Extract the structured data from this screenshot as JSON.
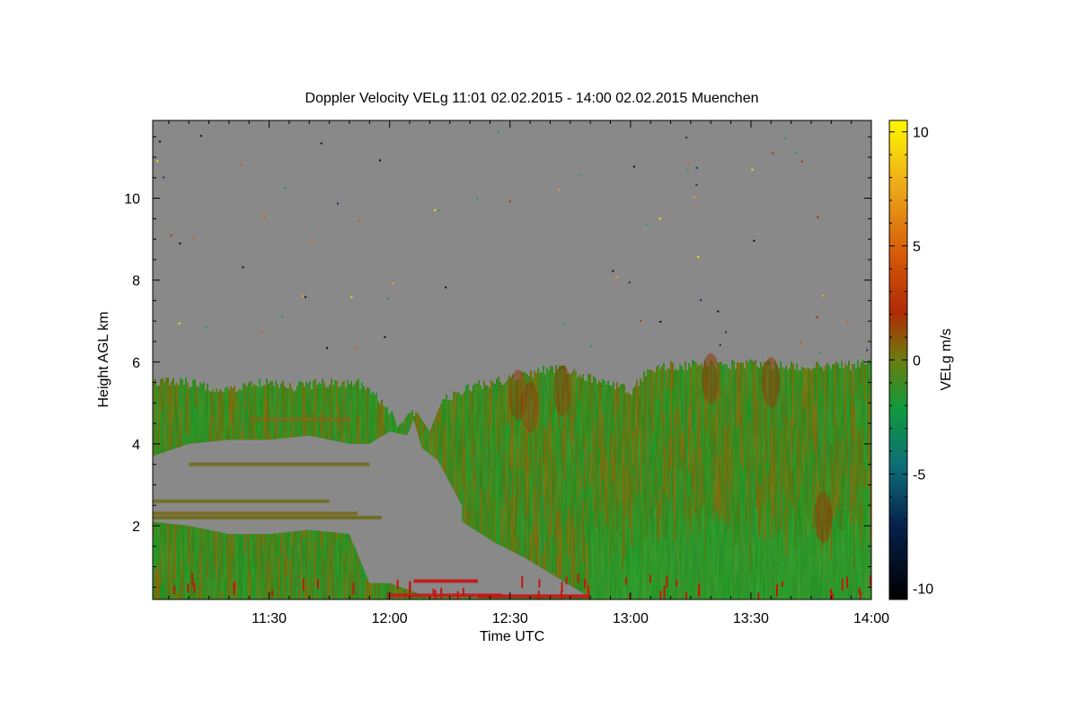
{
  "chart_data": {
    "type": "heatmap",
    "title": "Doppler Velocity VELg   11:01 02.02.2015 - 14:00 02.02.2015 Muenchen",
    "xlabel": "Time UTC",
    "ylabel": "Height AGL km",
    "x_start": "11:01",
    "x_end": "14:00",
    "x_tick_labels": [
      "11:30",
      "12:00",
      "12:30",
      "13:00",
      "13:30",
      "14:00"
    ],
    "x_tick_minutes": [
      30,
      60,
      90,
      120,
      150,
      180
    ],
    "xlim_minutes": [
      1,
      180
    ],
    "y_tick_labels": [
      "2",
      "4",
      "6",
      "8",
      "10"
    ],
    "y_ticks": [
      2,
      4,
      6,
      8,
      10
    ],
    "ylim": [
      0.2,
      11.9
    ],
    "colorbar": {
      "label": "VELg m/s",
      "range": [
        -10.5,
        10.5
      ],
      "tick_labels": [
        "-10",
        "-5",
        "0",
        "5",
        "10"
      ],
      "ticks": [
        -10,
        -5,
        0,
        5,
        10
      ]
    },
    "background_color": "#898989",
    "cloud_top_profile": {
      "minutes": [
        1,
        10,
        20,
        28,
        36,
        44,
        52,
        58,
        62,
        68,
        74,
        80,
        86,
        92,
        98,
        104,
        110,
        116,
        120,
        124,
        130,
        140,
        150,
        160,
        170,
        180
      ],
      "top_km": [
        5.5,
        5.5,
        5.3,
        5.5,
        5.4,
        5.5,
        5.5,
        5.0,
        4.6,
        4.8,
        5.1,
        5.4,
        5.5,
        5.6,
        5.8,
        5.8,
        5.6,
        5.4,
        5.3,
        5.8,
        5.9,
        5.95,
        5.95,
        5.9,
        5.9,
        5.95
      ]
    },
    "gap_profile": {
      "minutes": [
        1,
        10,
        20,
        30,
        40,
        50,
        55,
        60,
        65,
        68,
        72,
        78
      ],
      "gap_top_km": [
        3.7,
        4.0,
        4.1,
        4.1,
        4.2,
        4.0,
        4.0,
        4.3,
        4.2,
        3.9,
        3.6,
        2.5
      ],
      "gap_bottom_km": [
        2.1,
        2.0,
        1.8,
        1.8,
        1.9,
        1.8,
        0.6,
        0.6,
        0.5,
        0.8,
        1.0,
        1.2
      ]
    }
  }
}
